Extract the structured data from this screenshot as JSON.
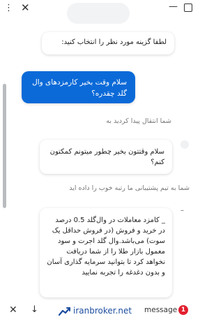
{
  "header": {
    "menu_icon": "⋮",
    "close_icon": "✕",
    "minimize_icon": "—",
    "agent_name": ""
  },
  "messages": {
    "agent_prompt": "لطفا گزینه مورد نظر را انتخاب کنید:",
    "user_message": "سلام وقت بخیر کارمزدهای وال گلد چقدره؟",
    "system_transfer": "شما انتقال پیدا کردید به",
    "agent_greeting": "سلام وقتتون بخیر چطور میتونم کمکتون کنم؟",
    "system_rating": "شما به تیم پشتیبانی ما رتبه خوب را داده اید",
    "agent_answer": "_ کامزد معاملات در وال‌گلد 0.5 درصد در خرید و فروش (در فروش حداقل یک سوت) می‌باشد.وال گلد اجرت و سود معمول بازار طلا را از شما دریافت نخواهد کرد تا بتوانید سرمایه گذاری آسان و بدون دغدغه را تجربه نمایید"
  },
  "footer": {
    "close_icon": "✕",
    "down_icon": "↓",
    "brand": "iranbroker.net",
    "message_label": "message",
    "badge_count": "1"
  },
  "colors": {
    "accent": "#0b6ad8",
    "brand": "#1d4ea0",
    "badge": "#e2202f"
  }
}
